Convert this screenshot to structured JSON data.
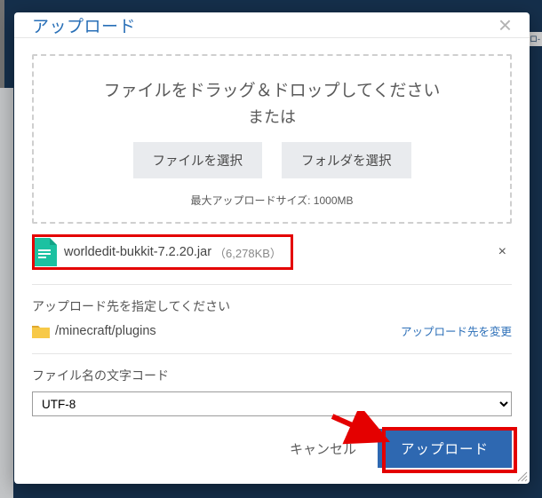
{
  "modal": {
    "title": "アップロード"
  },
  "dropzone": {
    "heading": "ファイルをドラッグ＆ドロップしてください",
    "or": "または",
    "choose_file_label": "ファイルを選択",
    "choose_folder_label": "フォルダを選択",
    "limit_text": "最大アップロードサイズ: 1000MB"
  },
  "file": {
    "name": "worldedit-bukkit-7.2.20.jar",
    "size": "（6,278KB）"
  },
  "destination": {
    "section_label": "アップロード先を指定してください",
    "path": "/minecraft/plugins",
    "change_label": "アップロード先を変更"
  },
  "encoding": {
    "section_label": "ファイル名の文字コード",
    "value": "UTF-8"
  },
  "footer": {
    "cancel_label": "キャンセル",
    "upload_label": "アップロード"
  },
  "bg": {
    "login_frag": "ロ-"
  }
}
